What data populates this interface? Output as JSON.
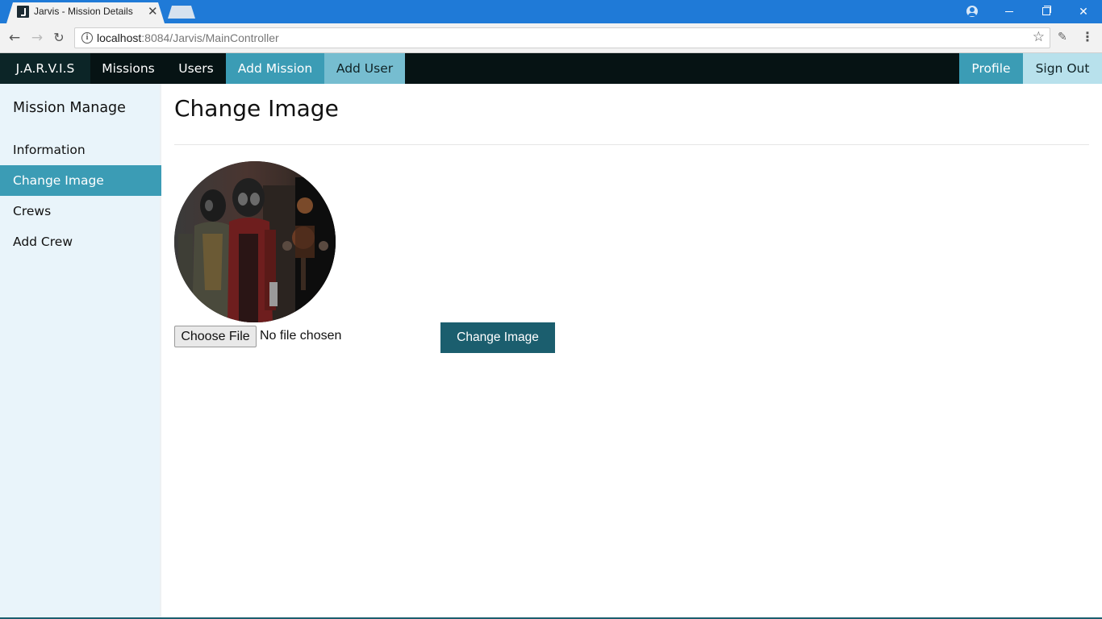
{
  "browser": {
    "tab_title": "Jarvis - Mission Details",
    "url_host": "localhost",
    "url_rest": ":8084/Jarvis/MainController"
  },
  "navbar": {
    "brand": "J.A.R.V.I.S",
    "items": [
      "Missions",
      "Users",
      "Add Mission",
      "Add User"
    ],
    "right_items": [
      "Profile",
      "Sign Out"
    ]
  },
  "sidebar": {
    "heading": "Mission Manage",
    "items": [
      "Information",
      "Change Image",
      "Crews",
      "Add Crew"
    ],
    "active": "Change Image"
  },
  "main": {
    "title": "Change Image",
    "file_button": "Choose File",
    "file_status": "No file chosen",
    "submit_label": "Change Image"
  },
  "colors": {
    "titlebar": "#1f7ad7",
    "navbar_bg": "#061314",
    "accent": "#3b9cb5",
    "submit": "#1b5e6e",
    "sidebar_bg": "#e9f4fa"
  },
  "icons": [
    "info-icon",
    "star-icon",
    "back-arrow-icon",
    "forward-arrow-icon",
    "reload-icon",
    "menu-icon",
    "close-icon"
  ]
}
